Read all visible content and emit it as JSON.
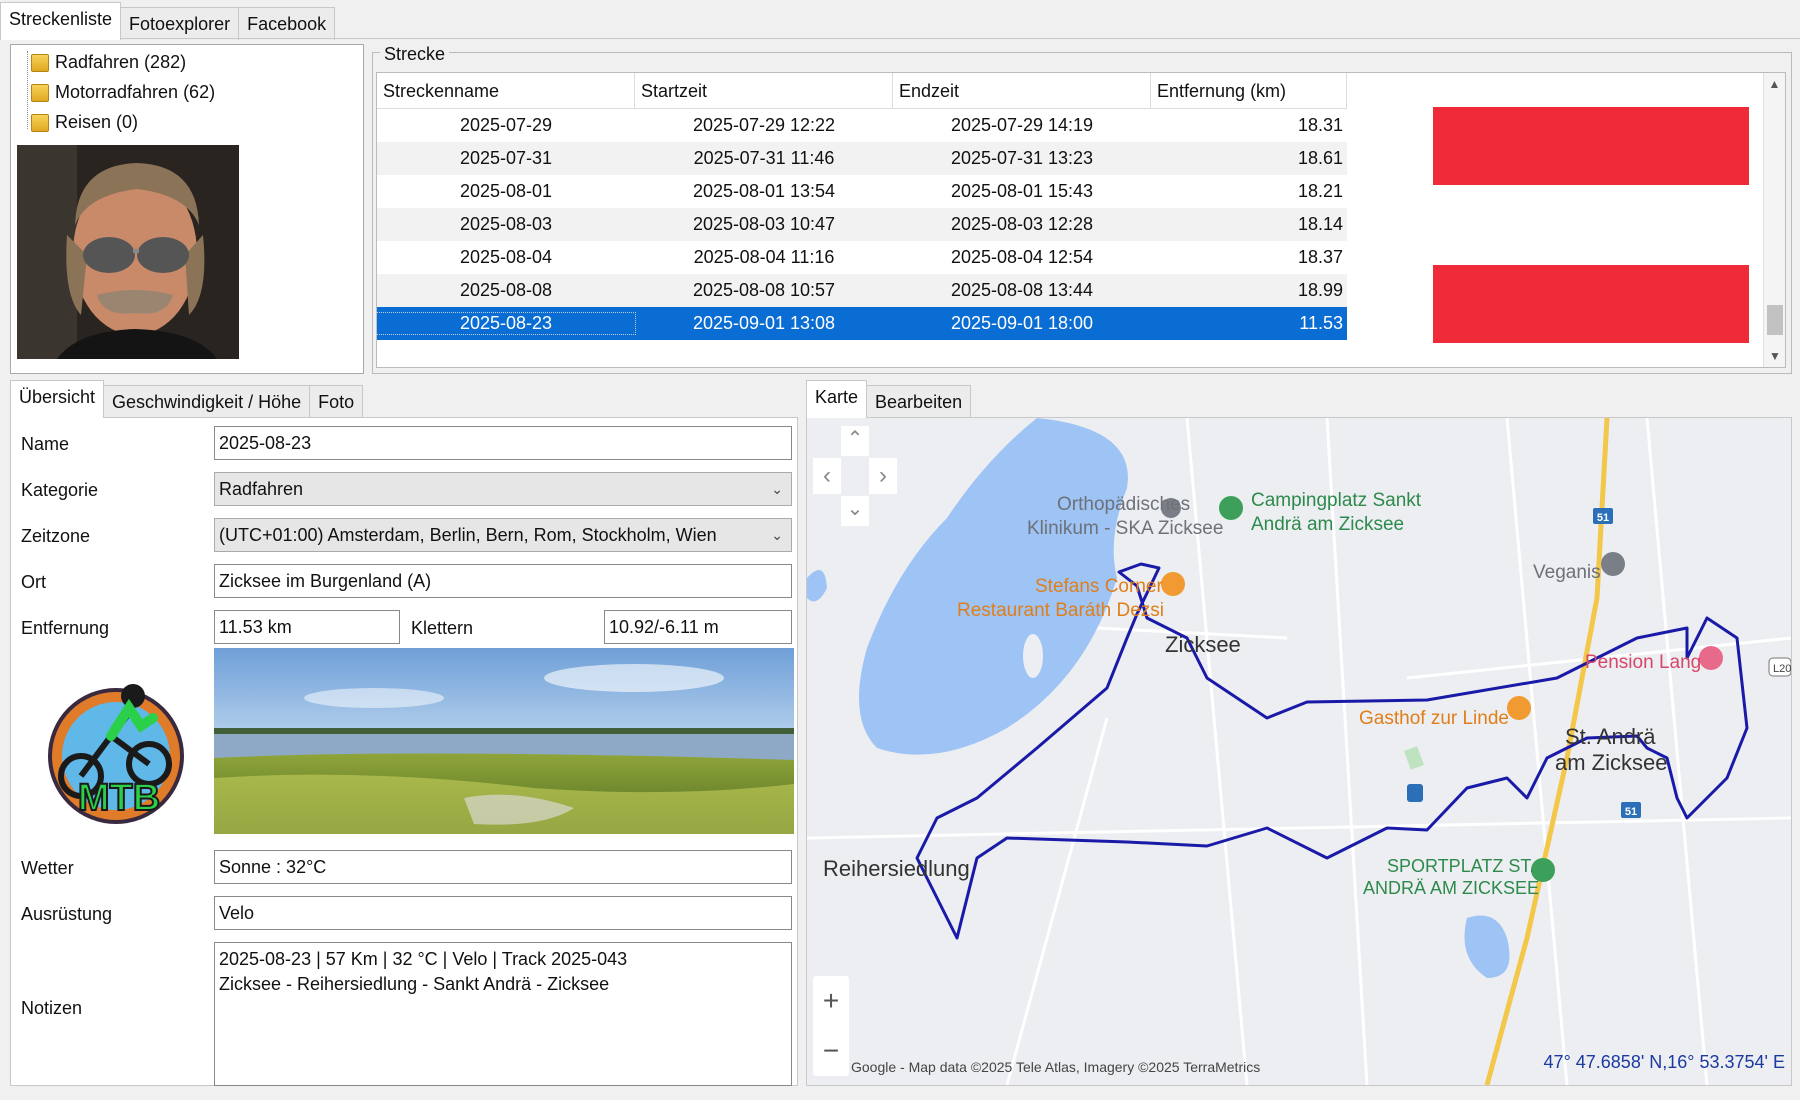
{
  "top_tabs": [
    "Streckenliste",
    "Fotoexplorer",
    "Facebook"
  ],
  "tree": [
    {
      "label": "Radfahren (282)"
    },
    {
      "label": "Motorradfahren (62)"
    },
    {
      "label": "Reisen (0)"
    }
  ],
  "strecke": {
    "title": "Strecke",
    "columns": [
      "Streckenname",
      "Startzeit",
      "Endzeit",
      "Entfernung (km)"
    ],
    "rows": [
      [
        "2025-07-29",
        "2025-07-29 12:22",
        "2025-07-29 14:19",
        "18.31"
      ],
      [
        "2025-07-31",
        "2025-07-31 11:46",
        "2025-07-31 13:23",
        "18.61"
      ],
      [
        "2025-08-01",
        "2025-08-01 13:54",
        "2025-08-01 15:43",
        "18.21"
      ],
      [
        "2025-08-03",
        "2025-08-03 10:47",
        "2025-08-03 12:28",
        "18.14"
      ],
      [
        "2025-08-04",
        "2025-08-04 11:16",
        "2025-08-04 12:54",
        "18.37"
      ],
      [
        "2025-08-08",
        "2025-08-08 10:57",
        "2025-08-08 13:44",
        "18.99"
      ],
      [
        "2025-08-23",
        "2025-09-01 13:08",
        "2025-09-01 18:00",
        "11.53"
      ]
    ],
    "selected_row": 6
  },
  "detail_tabs": [
    "Übersicht",
    "Geschwindigkeit / Höhe",
    "Foto"
  ],
  "form": {
    "name_label": "Name",
    "name_value": "2025-08-23",
    "kategorie_label": "Kategorie",
    "kategorie_value": "Radfahren",
    "zeitzone_label": "Zeitzone",
    "zeitzone_value": "(UTC+01:00) Amsterdam, Berlin, Bern, Rom, Stockholm, Wien",
    "ort_label": "Ort",
    "ort_value": "Zicksee im Burgenland (A)",
    "entfernung_label": "Entfernung",
    "entfernung_value": "11.53 km",
    "klettern_label": "Klettern",
    "klettern_value": "10.92/-6.11 m",
    "wetter_label": "Wetter",
    "wetter_value": "Sonne  :  32°C",
    "ausruestung_label": "Ausrüstung",
    "ausruestung_value": "Velo",
    "notizen_label": "Notizen",
    "notizen_line1": "2025-08-23  |  57 Km  |  32 °C  |  Velo  |  Track 2025-043",
    "notizen_line2": "Zicksee - Reihersiedlung - Sankt Andrä - Zicksee"
  },
  "logo_text": "MTB",
  "map_tabs": [
    "Karte",
    "Bearbeiten"
  ],
  "map": {
    "labels": {
      "ortho1": "Orthopädisches",
      "ortho2": "Klinikum - SKA Zicksee",
      "camp1": "Campingplatz Sankt",
      "camp2": "Andrä am Zicksee",
      "stefans1": "Stefans Corner",
      "stefans2": "Restaurant Baráth Dezsi",
      "zicksee": "Zicksee",
      "veganis": "Veganis",
      "pension": "Pension Lang",
      "gasthof": "Gasthof zur Linde",
      "standra1": "St. Andrä",
      "standra2": "am Zicksee",
      "reiher": "Reihersiedlung",
      "sport1": "SPORTPLATZ ST.",
      "sport2": "ANDRÄ AM ZICKSEE",
      "road51": "51",
      "l20": "L20"
    },
    "attribution": "Google - Map data ©2025 Tele Atlas, Imagery ©2025 TerraMetrics",
    "coords": "47° 47.6858' N,16° 53.3754' E",
    "zoom_in": "+",
    "zoom_out": "−"
  },
  "colors": {
    "selection": "#0a6dd4",
    "flag_red": "#ef2b3a",
    "route": "#1a1aa8",
    "water": "#9ec3f5",
    "coords": "#1a3aa0"
  }
}
